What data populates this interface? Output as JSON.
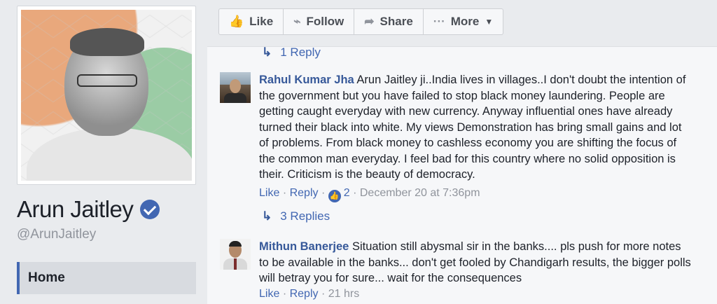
{
  "profile": {
    "name": "Arun Jaitley",
    "handle": "@ArunJaitley",
    "nav": {
      "home": "Home"
    }
  },
  "actions": {
    "like": "Like",
    "follow": "Follow",
    "share": "Share",
    "more": "More"
  },
  "comments": {
    "top_reply": "1 Reply",
    "c1": {
      "author": "Rahul Kumar Jha",
      "text": "Arun Jaitley ji..India lives in villages..I don't doubt the intention of the government but you have failed to stop black money laundering. People are getting caught everyday with new currency. Anyway influential ones have already turned their black into white. My views Demonstration has bring small gains and lot of problems. From black money to cashless economy you are shifting the focus of the common man everyday. I feel bad for this country where no solid opposition is their. Criticism is the beauty of democracy.",
      "like": "Like",
      "reply": "Reply",
      "likes": "2",
      "time": "December 20 at 7:36pm",
      "replies": "3 Replies"
    },
    "c2": {
      "author": "Mithun Banerjee",
      "text": "Situation still abysmal sir in the banks.... pls push for more notes to be available in the banks... don't get fooled by Chandigarh results, the bigger polls will betray you for sure... wait for the consequences",
      "like": "Like",
      "reply": "Reply",
      "time": "21 hrs"
    }
  }
}
